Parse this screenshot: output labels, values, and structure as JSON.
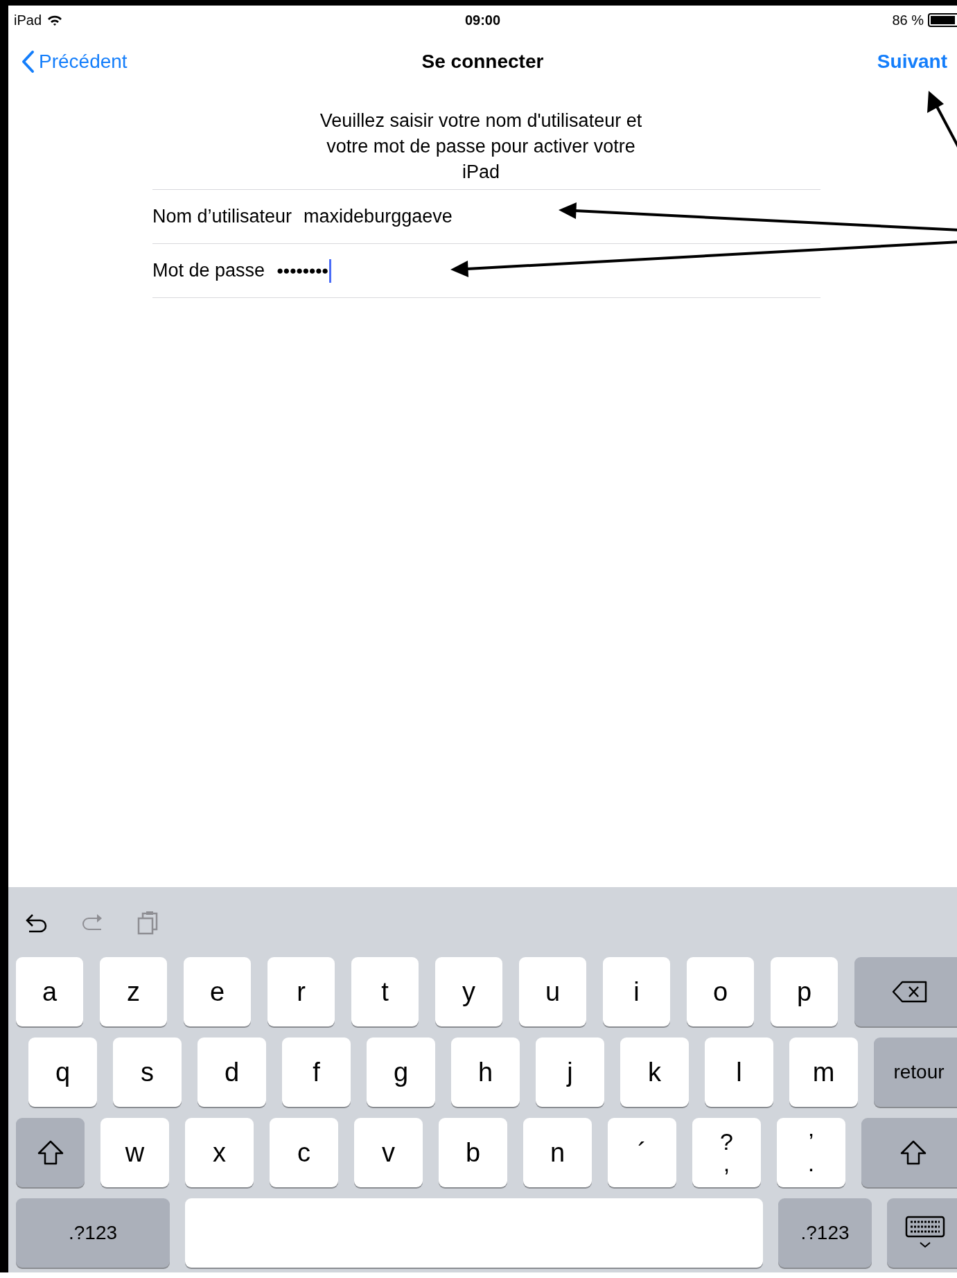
{
  "status_bar": {
    "device": "iPad",
    "time": "09:00",
    "battery": "86 %"
  },
  "nav_bar": {
    "back": "Précédent",
    "title": "Se connecter",
    "next": "Suivant"
  },
  "instructions": "Veuillez saisir votre nom d'utilisateur et votre mot de passe pour activer votre iPad",
  "fields": [
    {
      "label": "Nom d’utilisateur",
      "value": "maxideburggaeve",
      "focused": false
    },
    {
      "label": "Mot de passe",
      "value": "●●●●●●●●",
      "focused": true
    }
  ],
  "keyboard": {
    "toolbar": [
      {
        "kind": "undo",
        "disabled": false
      },
      {
        "kind": "redo",
        "disabled": true
      },
      {
        "kind": "paste",
        "disabled": true
      }
    ],
    "rows": [
      [
        {
          "kind": "char",
          "label": "a"
        },
        {
          "kind": "char",
          "label": "z"
        },
        {
          "kind": "char",
          "label": "e"
        },
        {
          "kind": "char",
          "label": "r"
        },
        {
          "kind": "char",
          "label": "t"
        },
        {
          "kind": "char",
          "label": "y"
        },
        {
          "kind": "char",
          "label": "u"
        },
        {
          "kind": "char",
          "label": "i"
        },
        {
          "kind": "char",
          "label": "o"
        },
        {
          "kind": "char",
          "label": "p"
        },
        {
          "kind": "backspace"
        }
      ],
      [
        {
          "kind": "char",
          "label": "q"
        },
        {
          "kind": "char",
          "label": "s"
        },
        {
          "kind": "char",
          "label": "d"
        },
        {
          "kind": "char",
          "label": "f"
        },
        {
          "kind": "char",
          "label": "g"
        },
        {
          "kind": "char",
          "label": "h"
        },
        {
          "kind": "char",
          "label": "j"
        },
        {
          "kind": "char",
          "label": "k"
        },
        {
          "kind": "char",
          "label": "l"
        },
        {
          "kind": "char",
          "label": "m"
        },
        {
          "kind": "return",
          "label": "retour"
        }
      ],
      [
        {
          "kind": "shift"
        },
        {
          "kind": "char",
          "label": "w"
        },
        {
          "kind": "char",
          "label": "x"
        },
        {
          "kind": "char",
          "label": "c"
        },
        {
          "kind": "char",
          "label": "v"
        },
        {
          "kind": "char",
          "label": "b"
        },
        {
          "kind": "char",
          "label": "n"
        },
        {
          "kind": "char",
          "label": "´"
        },
        {
          "kind": "char",
          "label": "?",
          "sub": ","
        },
        {
          "kind": "char",
          "label": "’",
          "sub": "."
        },
        {
          "kind": "shift"
        }
      ]
    ],
    "bottom_row": {
      "left_numbers": ".?123",
      "right_numbers": ".?123"
    }
  }
}
